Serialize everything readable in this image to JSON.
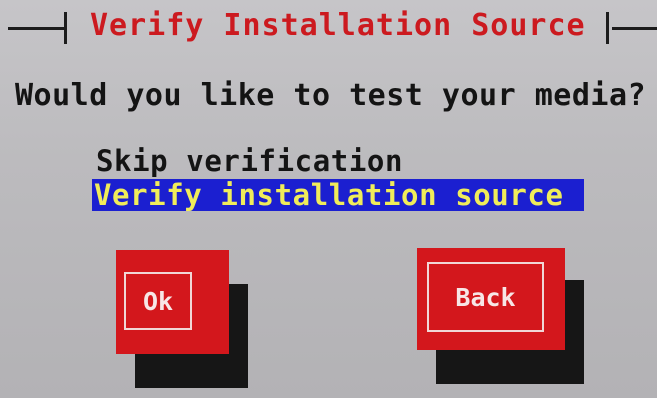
{
  "window": {
    "title": "Verify Installation Source"
  },
  "dialog": {
    "question": "Would you like to test your media?",
    "options": [
      {
        "label": "Skip verification",
        "selected": false
      },
      {
        "label": "Verify installation source",
        "selected": true
      }
    ],
    "buttons": {
      "ok_label": "Ok",
      "back_label": "Back"
    }
  },
  "colors": {
    "background": "#b7b6b9",
    "title_text": "#cc1a1f",
    "selection_bg": "#1b1fd0",
    "selection_text": "#f0ec5a",
    "button": "#d3171c",
    "shadow": "#161616"
  }
}
